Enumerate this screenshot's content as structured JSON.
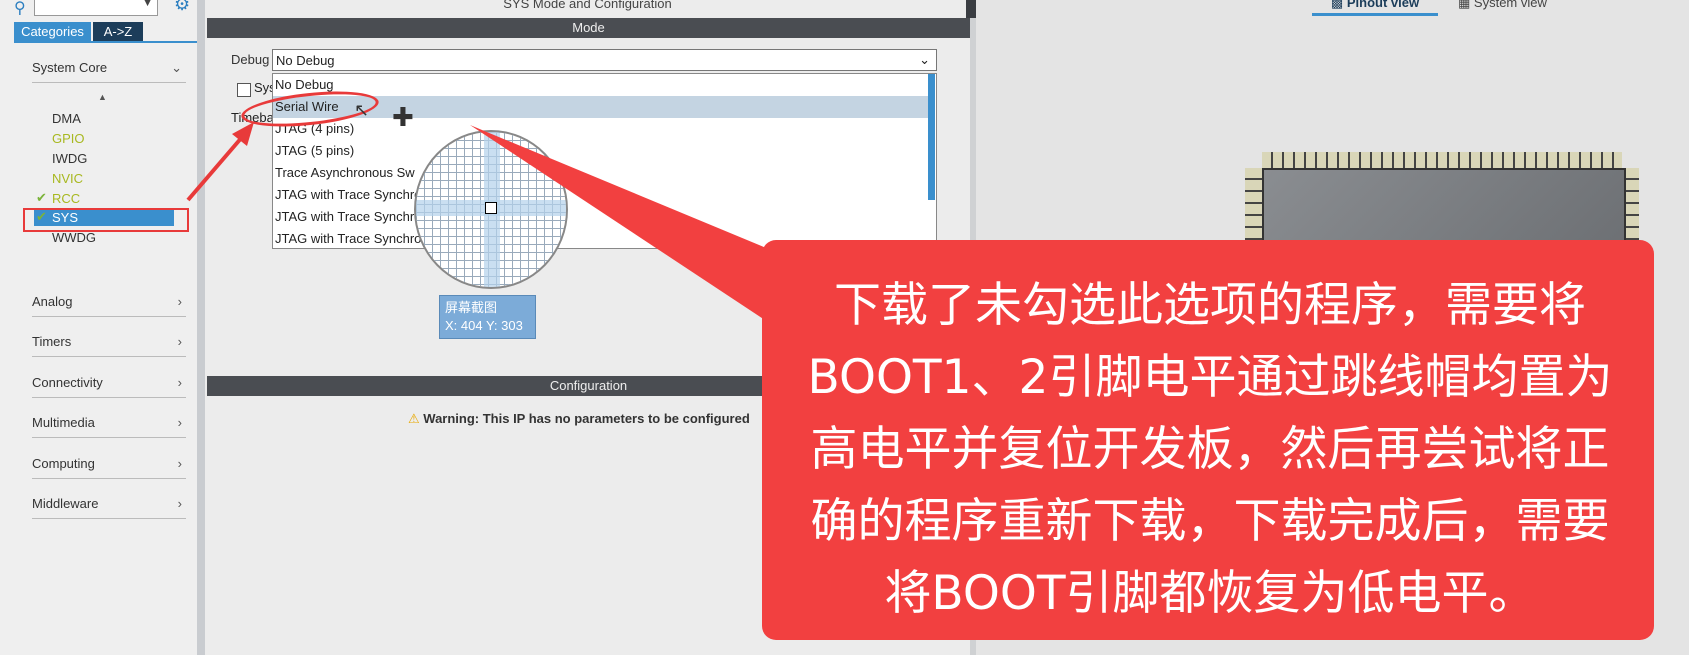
{
  "left_panel": {
    "tabs": [
      "Categories",
      "A->Z"
    ],
    "categories": [
      "System Core",
      "Analog",
      "Timers",
      "Connectivity",
      "Multimedia",
      "Computing",
      "Middleware"
    ],
    "system_core_items": [
      "DMA",
      "GPIO",
      "IWDG",
      "NVIC",
      "RCC",
      "SYS",
      "WWDG"
    ]
  },
  "center": {
    "title": "SYS Mode and Configuration",
    "mode_header": "Mode",
    "debug_label": "Debug",
    "debug_value": "No Debug",
    "debug_options": [
      "No Debug",
      "Serial Wire",
      "JTAG (4 pins)",
      "JTAG (5 pins)",
      "Trace Asynchronous Sw",
      "JTAG with Trace Synchro",
      "JTAG with Trace Synchro",
      "JTAG with Trace Synchro"
    ],
    "sys_checkbox_label": "Sys",
    "timebase_label": "Timeba",
    "config_header": "Configuration",
    "warning": "Warning: This IP has no parameters to be configured"
  },
  "overlay": {
    "screenshot_label": "屏幕截图",
    "coords": "X: 404 Y: 303",
    "callout": "下载了未勾选此选项的程序，需要将BOOT1、2引脚电平通过跳线帽均置为高电平并复位开发板，然后再尝试将正确的程序重新下载，下载完成后，需要将BOOT引脚都恢复为低电平。"
  },
  "right": {
    "pinout_tab": "Pinout view",
    "system_tab": "System view"
  },
  "colors": {
    "accent": "#3a8fcd",
    "annotation_red": "#e83a3a",
    "callout_red": "#f24040"
  }
}
